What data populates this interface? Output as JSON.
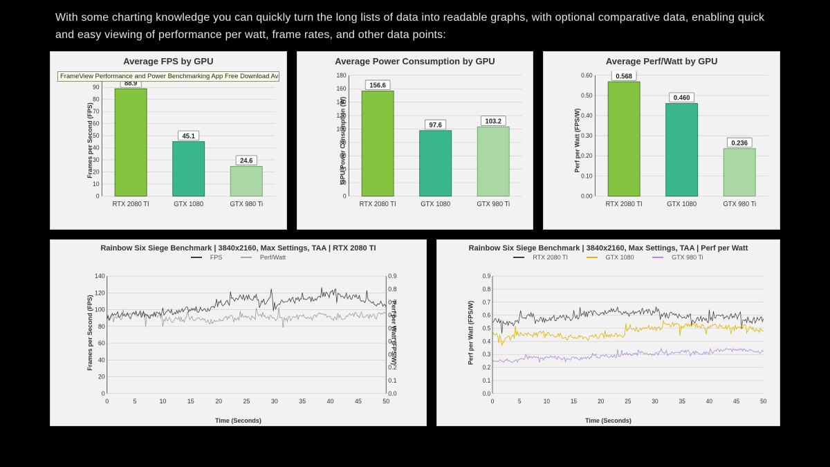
{
  "intro_text": "With some charting knowledge you can quickly turn the long lists of data into readable graphs, with optional comparative data, enabling quick and easy viewing of performance per watt, frame rates, and other data points:",
  "tooltip": "FrameView Performance and Power Benchmarking App Free Download Available Now",
  "charts": {
    "fps": {
      "title": "Average FPS by GPU",
      "ylabel": "Frames per Second (FPS)"
    },
    "power": {
      "title": "Average Power Consumption by GPU",
      "ylabel": "GPU Power Consumption (W)"
    },
    "ppw": {
      "title": "Average Perf/Watt by GPU",
      "ylabel": "Perf per Watt (FPS/W)"
    },
    "line1": {
      "title": "Rainbow Six Siege Benchmark | 3840x2160, Max Settings, TAA | RTX 2080 TI",
      "legend_a": "FPS",
      "legend_b": "Perf/Watt",
      "xlabel": "Time (Seconds)",
      "ylabel_l": "Frames per Second (FPS)",
      "ylabel_r": "Perf per Watt (FPS/W)"
    },
    "line2": {
      "title": "Rainbow Six Siege Benchmark | 3840x2160, Max Settings, TAA | Perf per Watt",
      "legend_a": "RTX 2080 TI",
      "legend_b": "GTX 1080",
      "legend_c": "GTX 980 Ti",
      "xlabel": "Time (Seconds)",
      "ylabel": "Perf per Watt (FPS/W)"
    }
  },
  "chart_data": [
    {
      "id": "fps",
      "type": "bar",
      "title": "Average FPS by GPU",
      "ylabel": "Frames per Second (FPS)",
      "categories": [
        "RTX 2080 TI",
        "GTX 1080",
        "GTX 980 Ti"
      ],
      "values": [
        88.9,
        45.1,
        24.6
      ],
      "ylim": [
        0,
        100
      ],
      "ytick": 10
    },
    {
      "id": "power",
      "type": "bar",
      "title": "Average Power Consumption by GPU",
      "ylabel": "GPU Power Consumption (W)",
      "categories": [
        "RTX 2080 TI",
        "GTX 1080",
        "GTX 980 Ti"
      ],
      "values": [
        156.6,
        97.6,
        103.2
      ],
      "ylim": [
        0,
        180
      ],
      "ytick": 20
    },
    {
      "id": "ppw",
      "type": "bar",
      "title": "Average Perf/Watt by GPU",
      "ylabel": "Perf per Watt (FPS/W)",
      "categories": [
        "RTX 2080 TI",
        "GTX 1080",
        "GTX 980 Ti"
      ],
      "values": [
        0.568,
        0.46,
        0.236
      ],
      "ylim": [
        0,
        0.6
      ],
      "ytick": 0.1,
      "decimals": 2
    },
    {
      "id": "line1",
      "type": "line",
      "title": "Rainbow Six Siege Benchmark | 3840x2160, Max Settings, TAA | RTX 2080 TI",
      "xlabel": "Time (Seconds)",
      "xlim": [
        0,
        50
      ],
      "xtick": 5,
      "left_axis": {
        "label": "Frames per Second (FPS)",
        "ylim": [
          0,
          140
        ],
        "ytick": 20
      },
      "right_axis": {
        "label": "Perf per Watt (FPS/W)",
        "ylim": [
          0,
          0.9
        ],
        "ytick": 0.1
      },
      "series": [
        {
          "name": "FPS",
          "axis": "left",
          "approx_mean": 90,
          "approx_range": [
            75,
            110
          ]
        },
        {
          "name": "Perf/Watt",
          "axis": "right",
          "approx_mean": 0.57,
          "approx_range": [
            0.48,
            0.68
          ]
        }
      ]
    },
    {
      "id": "line2",
      "type": "line",
      "title": "Rainbow Six Siege Benchmark | 3840x2160, Max Settings, TAA | Perf per Watt",
      "xlabel": "Time (Seconds)",
      "ylabel": "Perf per Watt (FPS/W)",
      "xlim": [
        0,
        50
      ],
      "xtick": 5,
      "ylim": [
        0,
        0.9
      ],
      "ytick": 0.1,
      "series": [
        {
          "name": "RTX 2080 TI",
          "approx_mean": 0.57,
          "approx_range": [
            0.48,
            0.7
          ]
        },
        {
          "name": "GTX 1080",
          "approx_mean": 0.46,
          "approx_range": [
            0.38,
            0.55
          ]
        },
        {
          "name": "GTX 980 Ti",
          "approx_mean": 0.24,
          "approx_range": [
            0.18,
            0.3
          ]
        }
      ]
    }
  ]
}
